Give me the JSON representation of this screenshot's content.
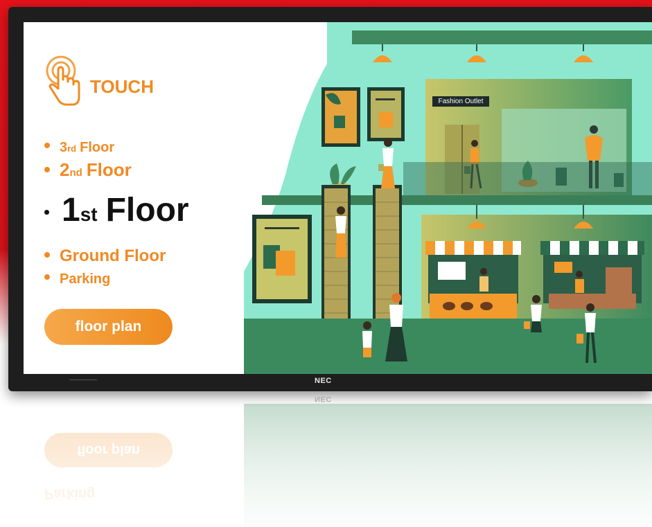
{
  "display": {
    "brand": "NEC"
  },
  "menu": {
    "touch_label": "TOUCH",
    "floors": [
      {
        "label": "3rd Floor",
        "ordinal_num": "3",
        "ordinal_suffix": "rd",
        "word": "Floor",
        "active": false
      },
      {
        "label": "2nd Floor",
        "ordinal_num": "2",
        "ordinal_suffix": "nd",
        "word": "Floor",
        "active": false
      },
      {
        "label": "1st Floor",
        "ordinal_num": "1",
        "ordinal_suffix": "st",
        "word": "Floor",
        "active": true
      },
      {
        "label": "Ground Floor",
        "active": false
      },
      {
        "label": "Parking",
        "active": false
      }
    ],
    "floor_plan_button": "floor plan"
  },
  "scene": {
    "store_sign": "Fashion Outlet"
  },
  "colors": {
    "accent_orange": "#f08a24",
    "active_text": "#111111",
    "mint": "#7fe5cc",
    "dark_green": "#2f7d55",
    "olive": "#b3ad58",
    "bezel": "#1e1e1f",
    "background_red": "#e4121a"
  }
}
